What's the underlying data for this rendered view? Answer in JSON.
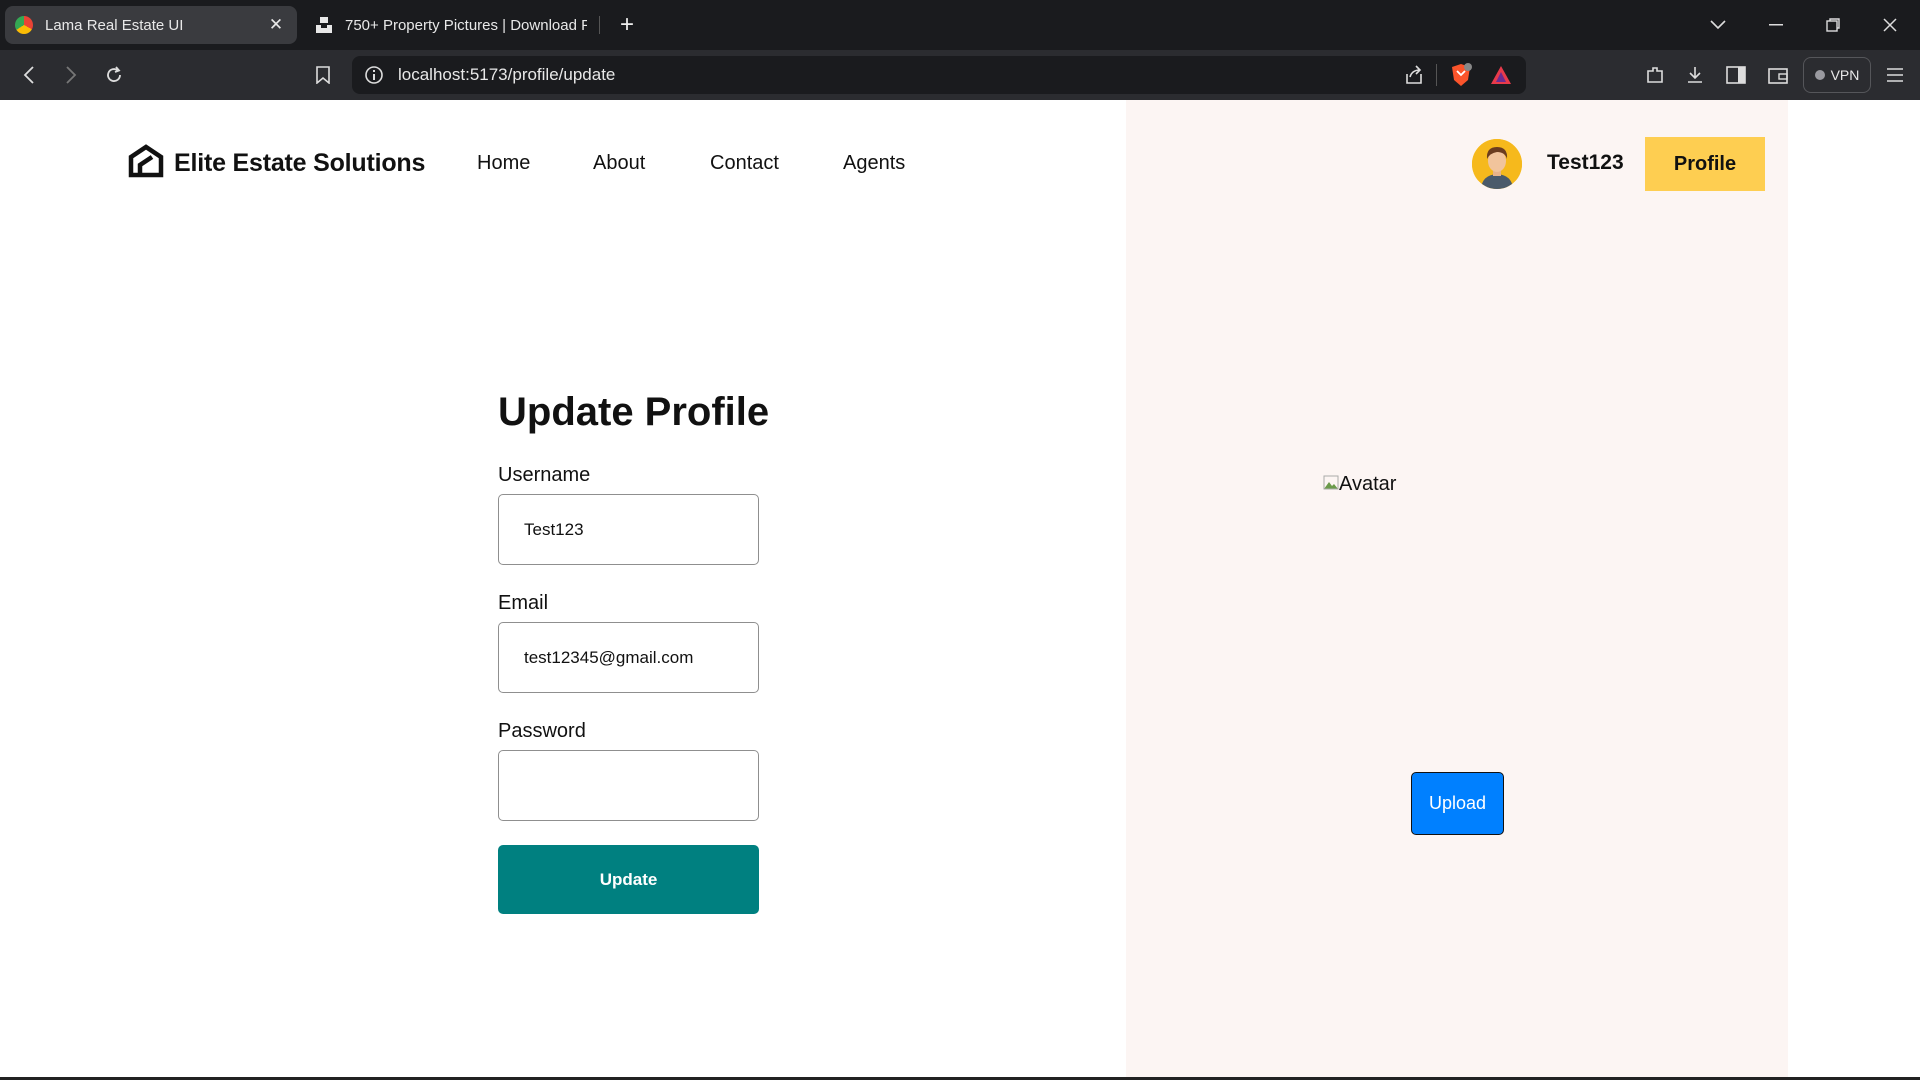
{
  "browser": {
    "tabs": [
      {
        "title": "Lama Real Estate UI",
        "active": true,
        "favicon": "chrome-logo-icon"
      },
      {
        "title": "750+ Property Pictures | Download F",
        "active": false,
        "favicon": "unsplash-icon"
      }
    ],
    "url": "localhost:5173/profile/update",
    "vpn_label": "VPN"
  },
  "navbar": {
    "brand": "Elite Estate Solutions",
    "links": [
      "Home",
      "About",
      "Contact",
      "Agents"
    ],
    "username": "Test123",
    "profile_label": "Profile"
  },
  "form": {
    "title": "Update Profile",
    "username_label": "Username",
    "username_value": "Test123",
    "email_label": "Email",
    "email_value": "test12345@gmail.com",
    "password_label": "Password",
    "password_value": "",
    "submit_label": "Update"
  },
  "side": {
    "avatar_alt": "Avatar",
    "upload_label": "Upload"
  },
  "colors": {
    "accent_yellow": "#fece51",
    "update_teal": "#008080",
    "upload_blue": "#0080ff",
    "panel_bg": "#fcf5f3"
  }
}
